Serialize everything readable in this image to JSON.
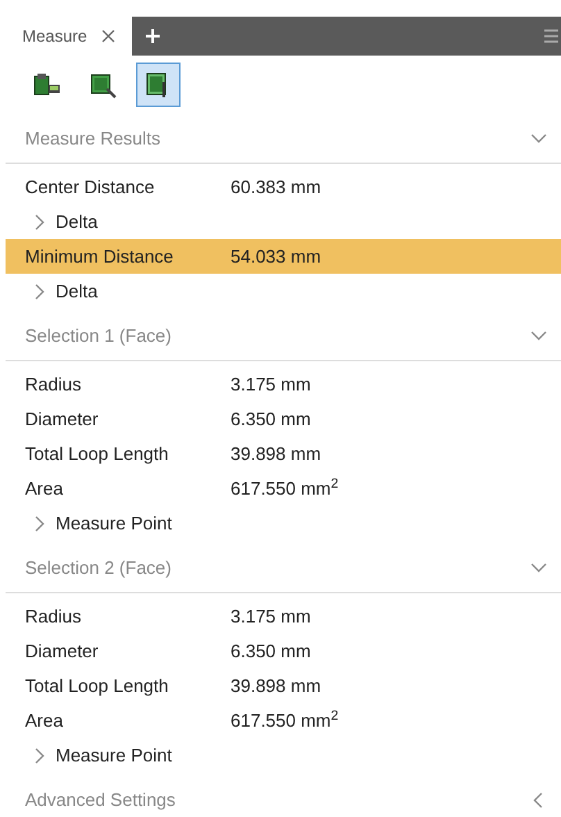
{
  "tabs": [
    {
      "label": "Measure",
      "selected": true,
      "closable": true
    }
  ],
  "toolbar": [
    {
      "selected": false
    },
    {
      "selected": false
    },
    {
      "selected": true
    }
  ],
  "sections": [
    {
      "title": "Measure Results",
      "expanded": true,
      "rows": [
        {
          "kind": "value",
          "label": "Center Distance",
          "value": "60.383 mm",
          "selected": false
        },
        {
          "kind": "expander",
          "label": "Delta",
          "expanded": false
        },
        {
          "kind": "value",
          "label": "Minimum Distance",
          "value": "54.033 mm",
          "selected": true
        },
        {
          "kind": "expander",
          "label": "Delta",
          "expanded": false
        }
      ]
    },
    {
      "title": "Selection 1 (Face)",
      "expanded": true,
      "rows": [
        {
          "kind": "value",
          "label": "Radius",
          "value": "3.175 mm",
          "selected": false
        },
        {
          "kind": "value",
          "label": "Diameter",
          "value": "6.350 mm",
          "selected": false
        },
        {
          "kind": "value",
          "label": "Total Loop Length",
          "value": "39.898 mm",
          "selected": false
        },
        {
          "kind": "value",
          "label": "Area",
          "value": "617.550 mm$^{2}$",
          "selected": false
        },
        {
          "kind": "expander",
          "label": "Measure Point",
          "expanded": false
        }
      ]
    },
    {
      "title": "Selection 2 (Face)",
      "expanded": true,
      "rows": [
        {
          "kind": "value",
          "label": "Radius",
          "value": "3.175 mm",
          "selected": false
        },
        {
          "kind": "value",
          "label": "Diameter",
          "value": "6.350 mm",
          "selected": false
        },
        {
          "kind": "value",
          "label": "Total Loop Length",
          "value": "39.898 mm",
          "selected": false
        },
        {
          "kind": "value",
          "label": "Area",
          "value": "617.550 mm$^{2}$",
          "selected": false
        },
        {
          "kind": "expander",
          "label": "Measure Point",
          "expanded": false
        }
      ]
    },
    {
      "title": "Advanced Settings",
      "expanded": false
    }
  ]
}
